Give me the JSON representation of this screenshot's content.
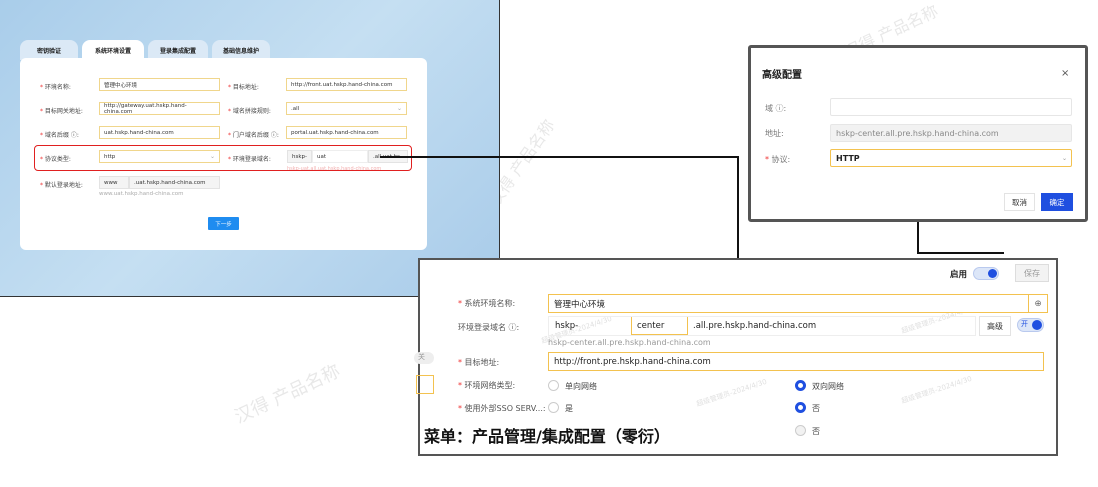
{
  "watermark": {
    "brand": "汉得 产品名称",
    "user_stamp": "超级管理员-2024/4/30"
  },
  "left": {
    "tabs": [
      "密钥验证",
      "系统环境设置",
      "登录集成配置",
      "基础信息维护"
    ],
    "active_tab": 1,
    "fields": {
      "env_name": {
        "label": "环境名称:",
        "value": "管理中心环境"
      },
      "target_addr": {
        "label": "目标地址:",
        "value": "http://front.uat.hskp.hand-china.com"
      },
      "gateway": {
        "label": "目标网关地址:",
        "value": "http://gateway.uat.hskp.hand-china.com"
      },
      "domain_rule": {
        "label": "域名拼接规则:",
        "value": ".all"
      },
      "domain_suffix": {
        "label": "域名后缀",
        "value": "uat.hskp.hand-china.com"
      },
      "portal_suffix": {
        "label": "门户域名后缀",
        "value": "portal.uat.hskp.hand-china.com"
      },
      "protocol": {
        "label": "协议类型:",
        "value": "http"
      },
      "login_domain": {
        "label": "环境登录域名:",
        "prefix": "hskp-",
        "value": "uat",
        "suffix": ".all.uat.hs",
        "hint": "hskp-uat.all.uat.hskp.hand-china.com"
      },
      "default_login": {
        "label": "默认登录地址:",
        "prefix": "www",
        "value": ".uat.hskp.hand-china.com",
        "hint": "www.uat.hskp.hand-china.com"
      }
    },
    "next_button": "下一步"
  },
  "right": {
    "enable_label": "启用",
    "save_button": "保存",
    "side_toggle": "关",
    "env_name": {
      "label": "系统环境名称:",
      "value": "管理中心环境"
    },
    "login_domain": {
      "label": "环境登录域名",
      "prefix": "hskp-",
      "value": "center",
      "suffix": ".all.pre.hskp.hand-china.com",
      "hint": "hskp-center.all.pre.hskp.hand-china.com",
      "advanced_button": "高级",
      "toggle": "开"
    },
    "target": {
      "label": "目标地址:",
      "value": "http://front.pre.hskp.hand-china.com"
    },
    "network": {
      "label": "环境网络类型:",
      "options": [
        "单向网络",
        "双向网络"
      ],
      "selected": 1
    },
    "sso": {
      "label": "使用外部SSO SERV...:",
      "options": [
        "是",
        "否"
      ],
      "selected": 1
    },
    "auto": {
      "options": [
        "否"
      ]
    },
    "caption": "菜单：产品管理/集成配置（零衍）"
  },
  "modal": {
    "title": "高级配置",
    "close": "×",
    "fields": [
      {
        "label": "域",
        "value": ""
      },
      {
        "label": "地址:",
        "value": "hskp-center.all.pre.hskp.hand-china.com"
      },
      {
        "label": "协议:",
        "value": "HTTP"
      }
    ],
    "cancel": "取消",
    "confirm": "确定"
  }
}
